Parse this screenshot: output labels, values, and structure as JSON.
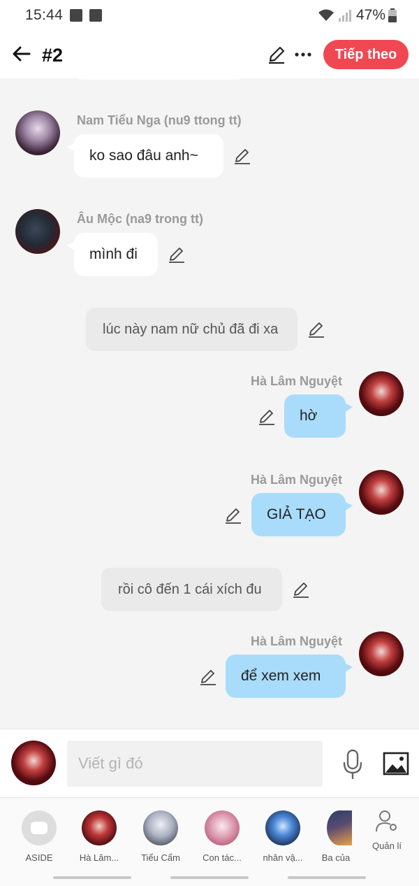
{
  "status_bar": {
    "time": "15:44",
    "battery": "47%"
  },
  "header": {
    "title": "#2",
    "next_label": "Tiếp theo"
  },
  "messages": [
    {
      "speaker": "Nam Tiểu Nga (nu9 ttong tt)",
      "text": "ko sao đâu anh~",
      "side": "left"
    },
    {
      "speaker": "Âu Mộc (na9 trong tt)",
      "text": "mình đi",
      "side": "left"
    },
    {
      "narration": "lúc này nam nữ chủ đã đi xa"
    },
    {
      "speaker": "Hà Lâm Nguyệt",
      "text": "hờ",
      "side": "right"
    },
    {
      "speaker": "Hà Lâm Nguyệt",
      "text": "GIẢ TẠO",
      "side": "right"
    },
    {
      "narration": "rồi cô đến 1 cái xích đu"
    },
    {
      "speaker": "Hà Lâm Nguyệt",
      "text": "để xem xem",
      "side": "right"
    }
  ],
  "composer": {
    "placeholder": "Viết gì đó"
  },
  "characters": [
    {
      "label": "ASIDE"
    },
    {
      "label": "Hà Lâm..."
    },
    {
      "label": "Tiểu Cẩm"
    },
    {
      "label": "Con tác..."
    },
    {
      "label": "nhân vậ..."
    },
    {
      "label": "Ba của"
    }
  ],
  "manage_label": "Quản lí",
  "colors": {
    "accent": "#f04852",
    "bubble_blue": "#a9dcfb"
  }
}
